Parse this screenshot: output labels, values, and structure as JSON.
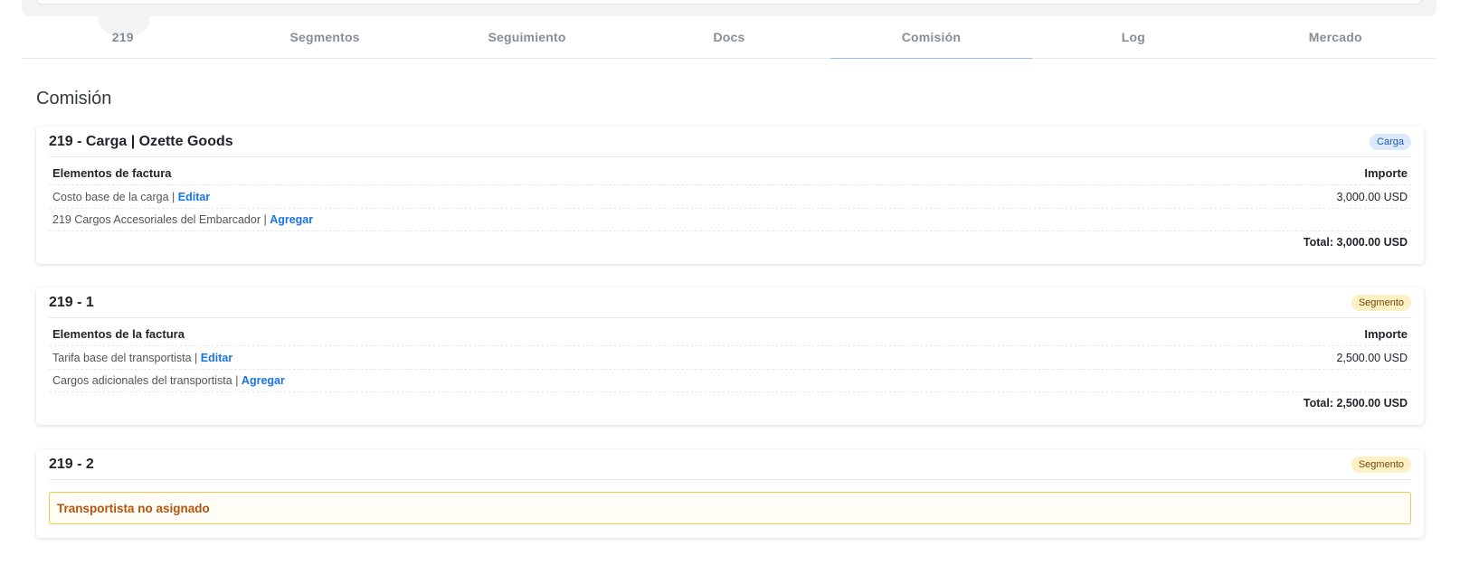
{
  "tabs": [
    "219",
    "Segmentos",
    "Seguimiento",
    "Docs",
    "Comisión",
    "Log",
    "Mercado"
  ],
  "active_tab": "Comisión",
  "section_title": "Comisión",
  "cards": [
    {
      "title": "219 - Carga | Ozette Goods",
      "badge": "Carga",
      "header_left": "Elementos de factura",
      "header_right": "Importe",
      "rows": [
        {
          "label": "Costo base de la carga | ",
          "link": "Editar",
          "amount": "3,000.00 USD"
        },
        {
          "label": "219 Cargos Accesoriales del Embarcador | ",
          "link": "Agregar",
          "amount": ""
        }
      ],
      "total": "Total: 3,000.00 USD"
    },
    {
      "title": "219 - 1",
      "badge": "Segmento",
      "header_left": "Elementos de la factura",
      "header_right": "Importe",
      "rows": [
        {
          "label": "Tarifa base del transportista | ",
          "link": "Editar",
          "amount": "2,500.00 USD"
        },
        {
          "label": "Cargos adicionales del transportista | ",
          "link": "Agregar",
          "amount": ""
        }
      ],
      "total": "Total: 2,500.00 USD"
    },
    {
      "title": "219 - 2",
      "badge": "Segmento",
      "alert": "Transportista no asignado"
    }
  ]
}
